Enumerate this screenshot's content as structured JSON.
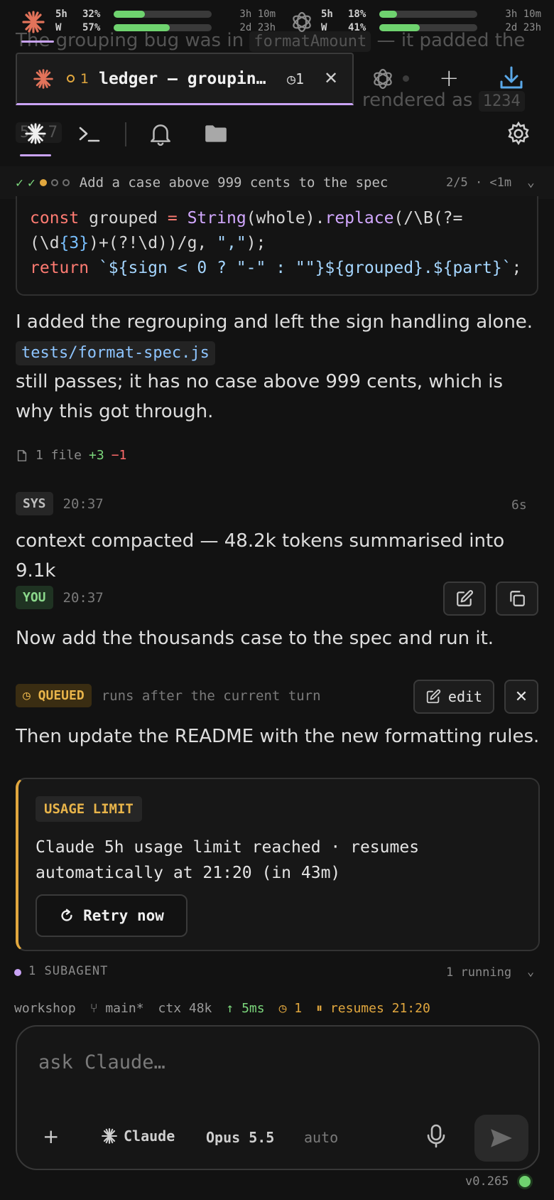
{
  "ghost": {
    "line1_pre": "The grouping bug was in ",
    "line1_code": "formatAmount",
    "line1_post": " — it padded the",
    "line2": "rendered as ",
    "line2_code": "1234",
    "line3_code": "56.7"
  },
  "usage": {
    "claude": {
      "row1_label": "5h",
      "row1_pct": "32%",
      "row1_fill": 0.32,
      "row1_time": "3h 10m",
      "row2_label": "W",
      "row2_pct": "57%",
      "row2_fill": 0.57,
      "row2_time": "2d 23h"
    },
    "openai": {
      "row1_label": "5h",
      "row1_pct": "18%",
      "row1_fill": 0.18,
      "row1_time": "3h 10m",
      "row2_label": "W",
      "row2_pct": "41%",
      "row2_fill": 0.41,
      "row2_time": "2d 23h"
    }
  },
  "tab": {
    "count": "1",
    "title": "ledger — groupin…",
    "timer": "◷1",
    "close": "✕"
  },
  "progress": {
    "text": "Add a case above 999 cents to the spec",
    "count": "2/5 · <1m"
  },
  "code": {
    "l1_kw": "const",
    "l1_var": " grouped ",
    "l1_eq": "= ",
    "l1_fn": "String",
    "l1_p1": "(",
    "l1_arg": "whole",
    "l1_p2": ").",
    "l1_fn2": "replace",
    "l1_p3": "(/",
    "l1_rx1": "\\B",
    "l1_p4": "(?=",
    "l2_p1": "(\\d",
    "l2_n": "{3}",
    "l2_p2": ")+(?!",
    "l2_rx": "\\d",
    "l2_p3": "))/g, ",
    "l2_s": "\",\"",
    "l2_p4": ");",
    "l3_kw": "return",
    "l3_a": " `${sign < 0 ? \"-\" : \"\"}${grouped}.${part}`",
    "l3_end": ";"
  },
  "assistant": {
    "line1": "I added the regrouping and left the sign handling alone.",
    "file_chip": "tests/format-spec.js",
    "line2": "still passes; it has no case above 999 cents, which is why this got through."
  },
  "filesum": {
    "label": "1 file",
    "add": "+3",
    "del": "−1"
  },
  "sys": {
    "badge": "SYS",
    "time": "20:37",
    "dur": "6s",
    "text": "context compacted — 48.2k tokens summarised into 9.1k"
  },
  "you": {
    "badge": "YOU",
    "time": "20:37",
    "text": "Now add the thousands case to the spec and run it."
  },
  "queued": {
    "badge": "◷ QUEUED",
    "note": "runs after the current turn",
    "edit": "edit",
    "text": "Then update the README with the new formatting rules."
  },
  "limit": {
    "badge": "USAGE LIMIT",
    "text": "Claude 5h usage limit reached · resumes automatically at 21:20 (in 43m)",
    "retry": "Retry now"
  },
  "subagent": {
    "title": "1 SUBAGENT",
    "running": "1 running"
  },
  "status": {
    "workspace": "workshop",
    "branch": "⑂ main*",
    "ctx": "ctx 48k",
    "latency": "↑ 5ms",
    "queued": "◷ 1",
    "paused": "⏸ resumes 21:20"
  },
  "composer": {
    "placeholder": "ask Claude…",
    "agent": "Claude",
    "model": "Opus 5.5",
    "mode": "auto"
  },
  "version": "v0.265",
  "colors": {
    "accent": "#c9a3f5",
    "amber": "#e1a73e",
    "green": "#6fd36f"
  }
}
